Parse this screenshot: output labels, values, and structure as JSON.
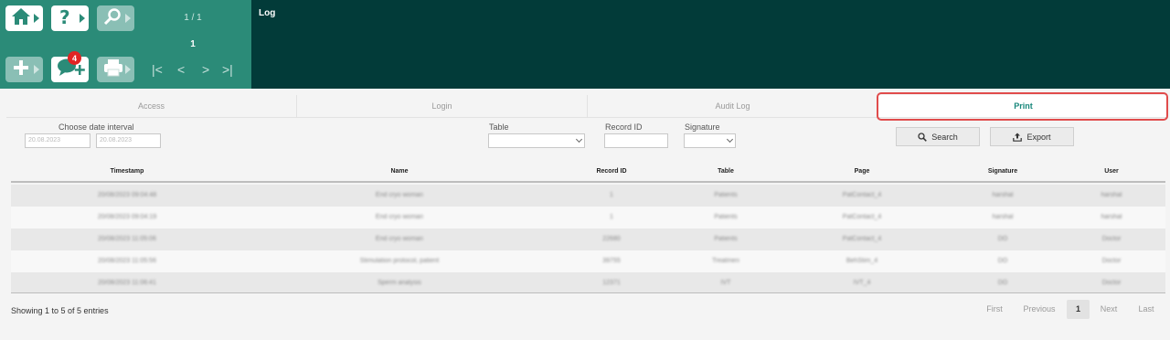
{
  "header": {
    "title": "Log",
    "page_count": "1 / 1",
    "page_current": "1",
    "notification_count": "4"
  },
  "toolbar": {
    "icons": [
      "home-icon",
      "help-icon",
      "search-icon",
      "add-icon",
      "add-comment-icon",
      "print-icon"
    ],
    "nav": [
      "|<",
      "<",
      ">",
      ">|"
    ]
  },
  "tabs": [
    {
      "label": "Access"
    },
    {
      "label": "Login"
    },
    {
      "label": "Audit Log"
    },
    {
      "label": "Print"
    }
  ],
  "filters": {
    "date_interval_label": "Choose date interval",
    "date_from": "20.08.2023",
    "date_to": "20.08.2023",
    "table_label": "Table",
    "record_id_label": "Record ID",
    "signature_label": "Signature",
    "search_label": "Search",
    "export_label": "Export"
  },
  "table": {
    "columns": [
      "Timestamp",
      "Name",
      "Record ID",
      "Table",
      "Page",
      "Signature",
      "User"
    ],
    "rows": [
      [
        "20/08/2023 09:04:48",
        "End cryo woman",
        "1",
        "Patients",
        "PatContact_4",
        "harshal",
        "harshal"
      ],
      [
        "20/08/2023 09:04:19",
        "End cryo woman",
        "1",
        "Patients",
        "PatContact_4",
        "harshal",
        "harshal"
      ],
      [
        "20/08/2023 11:05:06",
        "End cryo woman",
        "22680",
        "Patients",
        "PatContact_4",
        "DO",
        "Doctor"
      ],
      [
        "20/08/2023 11:05:56",
        "Stimulation protocol, patient",
        "39755",
        "Treatmen",
        "BehStim_4",
        "DO",
        "Doctor"
      ],
      [
        "20/08/2023 11:06:41",
        "Sperm analysis",
        "12371",
        "IVT",
        "IVT_4",
        "DO",
        "Doctor"
      ]
    ]
  },
  "footer": {
    "info": "Showing 1 to 5 of 5 entries",
    "first": "First",
    "previous": "Previous",
    "current_page": "1",
    "next": "Next",
    "last": "Last"
  },
  "colors": {
    "header_bg": "#023b39",
    "toolbar_bg": "#2b8b78",
    "accent": "#17867a",
    "highlight": "#e04b4b"
  }
}
